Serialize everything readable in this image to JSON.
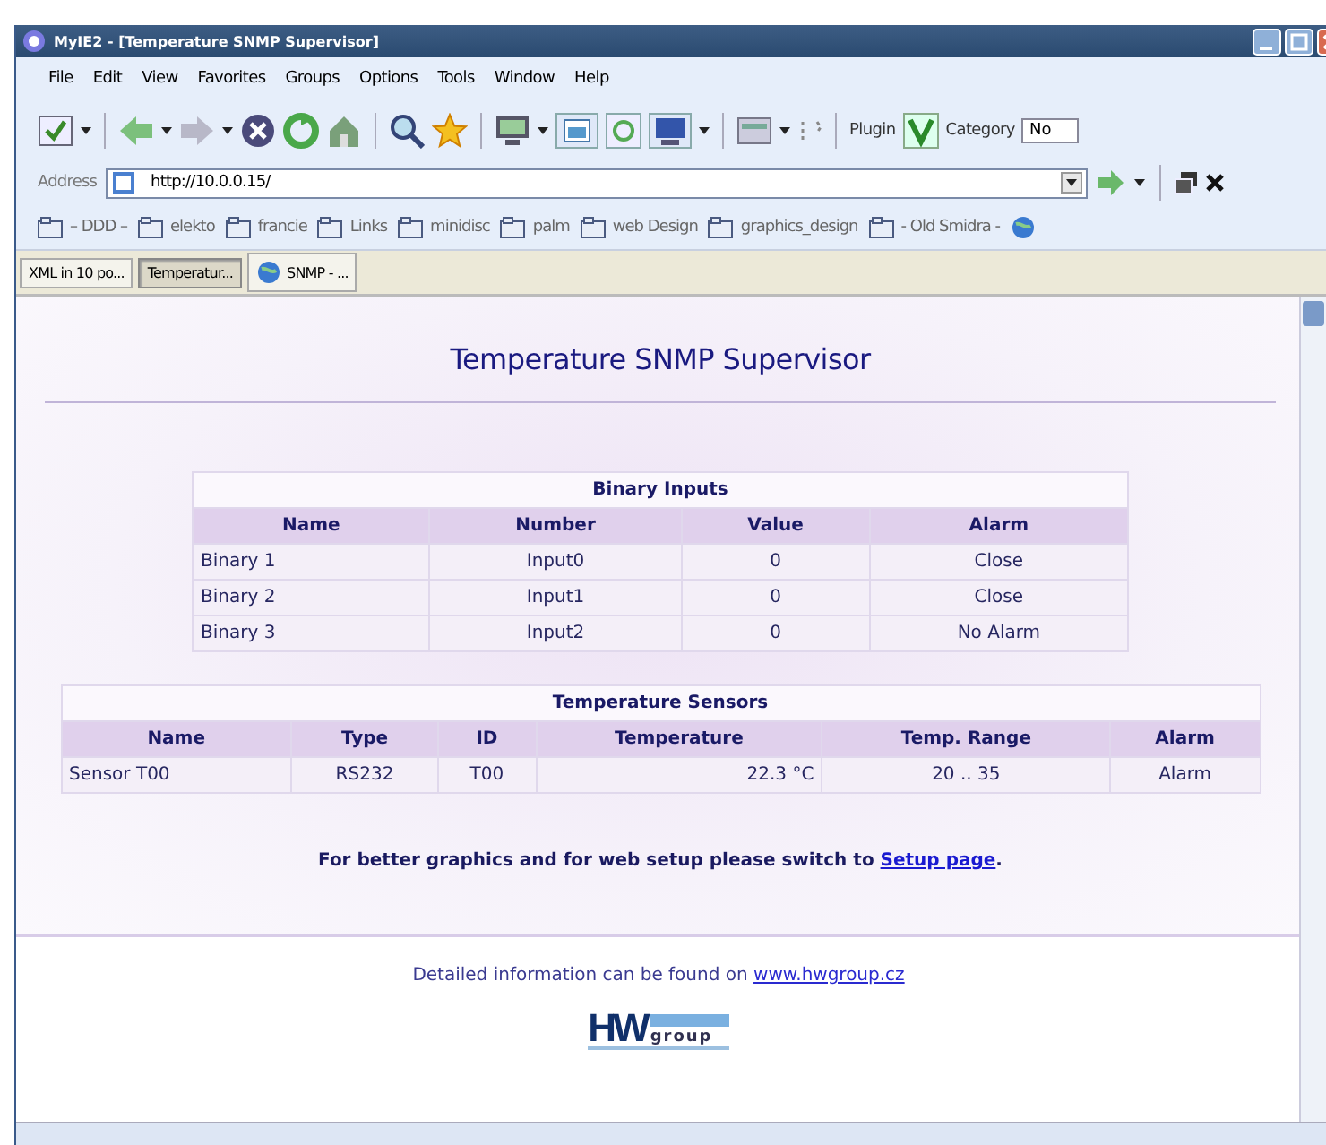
{
  "window": {
    "title": "MyIE2 - [Temperature SNMP Supervisor]"
  },
  "menu": [
    "File",
    "Edit",
    "View",
    "Favorites",
    "Groups",
    "Options",
    "Tools",
    "Window",
    "Help"
  ],
  "toolbar": {
    "plugin_label": "Plugin",
    "category_label": "Category",
    "category_value": "No"
  },
  "address": {
    "label": "Address",
    "value": "http://10.0.0.15/"
  },
  "links": [
    "– DDD –",
    "elekto",
    "francie",
    "Links",
    "minidisc",
    "palm",
    "web Design",
    "graphics_design",
    "- Old Smidra -"
  ],
  "tabs": [
    {
      "label": "XML in 10 po...",
      "selected": false
    },
    {
      "label": "Temperatur...",
      "selected": true
    },
    {
      "label": "SNMP - ...",
      "selected": false
    }
  ],
  "page": {
    "heading": "Temperature SNMP Supervisor",
    "binary_inputs": {
      "title": "Binary Inputs",
      "columns": [
        "Name",
        "Number",
        "Value",
        "Alarm"
      ],
      "rows": [
        [
          "Binary 1",
          "Input0",
          "0",
          "Close"
        ],
        [
          "Binary 2",
          "Input1",
          "0",
          "Close"
        ],
        [
          "Binary 3",
          "Input2",
          "0",
          "No Alarm"
        ]
      ]
    },
    "temperature_sensors": {
      "title": "Temperature Sensors",
      "columns": [
        "Name",
        "Type",
        "ID",
        "Temperature",
        "Temp. Range",
        "Alarm"
      ],
      "rows": [
        [
          "Sensor T00",
          "RS232",
          "T00",
          "22.3 °C",
          "20 .. 35",
          "Alarm"
        ]
      ]
    },
    "note": {
      "text": "For better graphics and for web setup please switch to",
      "link": "Setup page",
      "end": "."
    },
    "info": {
      "text": "Detailed information can be found on",
      "link": "www.hwgroup.cz"
    },
    "logo": {
      "main": "HW",
      "sub": "group"
    }
  }
}
